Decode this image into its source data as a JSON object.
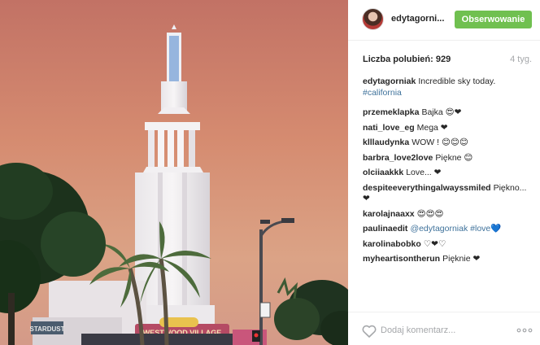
{
  "header": {
    "username": "edytagorni...",
    "follow_label": "Obserwowanie"
  },
  "stats": {
    "likes_label": "Liczba polubień:",
    "likes_count": "929",
    "age": "4 tyg."
  },
  "caption": {
    "user": "edytagorniak",
    "text": "Incredible sky today.",
    "hashtag": "#california"
  },
  "comments": [
    {
      "user": "przemeklapka",
      "text": "Bajka 😍❤"
    },
    {
      "user": "nati_love_eg",
      "text": "Mega ❤"
    },
    {
      "user": "klllaudynka",
      "text": "WOW ! 😊😊😊"
    },
    {
      "user": "barbra_love2love",
      "text": "Piękne 😊"
    },
    {
      "user": "olciiaakkk",
      "text": "Love... ❤"
    },
    {
      "user": "despiteeverythingalwayssmiled",
      "text": "Piękno... ❤"
    },
    {
      "user": "karolajnaaxx",
      "text": "😍😍😍"
    },
    {
      "user": "paulinaedit",
      "mention": "@edytagorniak",
      "hashtag": "#love",
      "emoji": "💙"
    },
    {
      "user": "karolinabobko",
      "text": "♡❤♡"
    },
    {
      "user": "myheartisontherun",
      "text": "Pięknie ❤"
    }
  ],
  "photo": {
    "signs": [
      "STARDUST",
      "WESTWOOD VILLAGE"
    ]
  },
  "footer": {
    "comment_placeholder": "Dodaj komentarz...",
    "like_icon": "heart-outline-icon",
    "more_icon": "more-options-icon"
  },
  "colors": {
    "follow_button": "#70c050",
    "link": "#3f729b",
    "muted": "#a5a7aa"
  }
}
